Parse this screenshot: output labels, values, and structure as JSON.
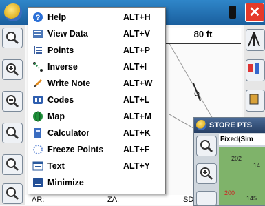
{
  "titlebar": {
    "close_glyph": "✕"
  },
  "map": {
    "scale_label": "80 ft"
  },
  "status": {
    "ar_label": "AR:",
    "za_label": "ZA:",
    "sd_label": "SD"
  },
  "store_panel": {
    "title": "STORE PTS",
    "field": "Fixed(Sim",
    "points": [
      "202",
      "14",
      "200",
      "145"
    ]
  },
  "menu": {
    "items": [
      {
        "label": "Help",
        "shortcut": "ALT+H",
        "icon": "help-icon",
        "color": "#2a6fd6"
      },
      {
        "label": "View Data",
        "shortcut": "ALT+V",
        "icon": "view-data-icon",
        "color": "#4b77b8"
      },
      {
        "label": "Points",
        "shortcut": "ALT+P",
        "icon": "points-icon",
        "color": "#3a5fa0"
      },
      {
        "label": "Inverse",
        "shortcut": "ALT+I",
        "icon": "inverse-icon",
        "color": "#2a8c4a"
      },
      {
        "label": "Write Note",
        "shortcut": "ALT+W",
        "icon": "pencil-icon",
        "color": "#e08a1e"
      },
      {
        "label": "Codes",
        "shortcut": "ALT+L",
        "icon": "codes-icon",
        "color": "#2f5fb0"
      },
      {
        "label": "Map",
        "shortcut": "ALT+M",
        "icon": "globe-icon",
        "color": "#1f8f3a"
      },
      {
        "label": "Calculator",
        "shortcut": "ALT+K",
        "icon": "calculator-icon",
        "color": "#3a6cc0"
      },
      {
        "label": "Freeze Points",
        "shortcut": "ALT+F",
        "icon": "freeze-icon",
        "color": "#6a8fd8"
      },
      {
        "label": "Text",
        "shortcut": "ALT+Y",
        "icon": "text-icon",
        "color": "#2a5a9e"
      },
      {
        "label": "Minimize",
        "shortcut": "",
        "icon": "minimize-icon",
        "color": "#234f96"
      }
    ]
  }
}
